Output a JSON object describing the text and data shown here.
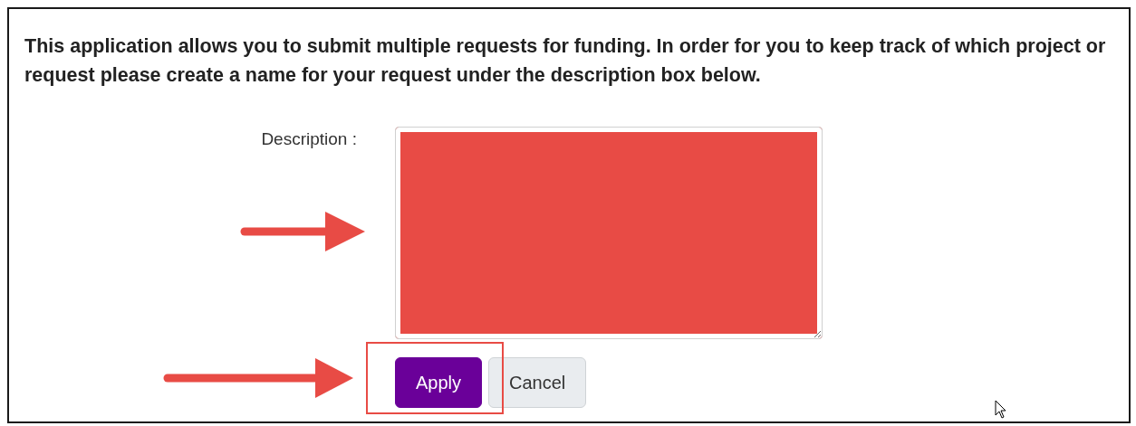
{
  "intro": "This application allows you to submit multiple requests for funding. In order for you to keep track of which project or request please create a name for your request under the description box below.",
  "description": {
    "label": "Description :"
  },
  "buttons": [
    {
      "label": "Apply",
      "kind": "primary"
    },
    {
      "label": "Cancel",
      "kind": "secondary"
    }
  ]
}
